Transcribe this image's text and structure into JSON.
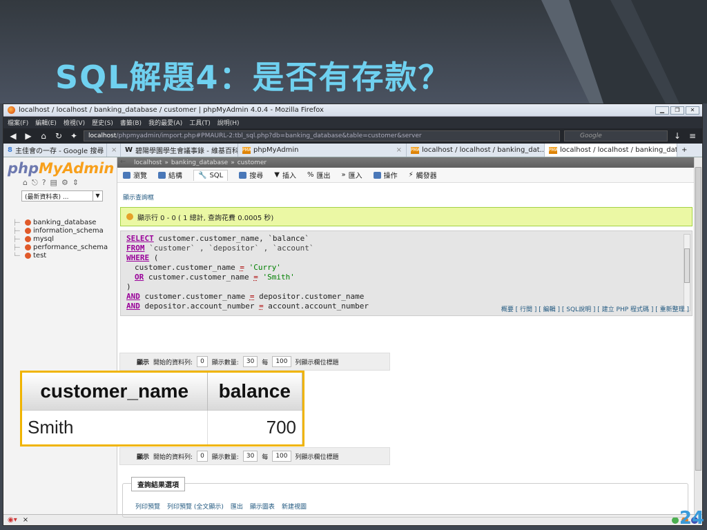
{
  "slide": {
    "title": "SQL解題4：是否有存款？",
    "page_number": "24"
  },
  "browser": {
    "window_title": "localhost / localhost / banking_database / customer | phpMyAdmin 4.0.4 - Mozilla Firefox",
    "menu": [
      "檔案(F)",
      "編輯(E)",
      "檢視(V)",
      "歷史(S)",
      "書籤(B)",
      "我的最愛(A)",
      "工具(T)",
      "說明(H)"
    ],
    "url_host": "localhost",
    "url_rest": "/phpmyadmin/import.php#PMAURL-2:tbl_sql.php?db=banking_database&table=customer&server",
    "search_placeholder": "Google",
    "tabs": [
      {
        "label": "主佳會の一存 - Google 搜尋"
      },
      {
        "label": "碧陽學園學生會議事錄 - 維基百科，..."
      },
      {
        "label": "phpMyAdmin"
      },
      {
        "label": "localhost / localhost / banking_dat..."
      },
      {
        "label": "localhost / localhost / banking_dat..."
      }
    ]
  },
  "pma": {
    "logo_php": "php",
    "logo_myadmin": "MyAdmin",
    "recent_select": "(最新資料表) ...",
    "databases": [
      "banking_database",
      "information_schema",
      "mysql",
      "performance_schema",
      "test"
    ],
    "breadcrumb": {
      "server": "localhost",
      "database": "banking_database",
      "table": "customer"
    },
    "tabs": [
      "瀏覽",
      "結構",
      "SQL",
      "搜尋",
      "插入",
      "匯出",
      "匯入",
      "操作",
      "觸發器"
    ],
    "show_query_box": "顯示查詢框",
    "success_message": "顯示行 0 - 0 ( 1 總計, 查詢花費 0.0005 秒)",
    "sql_lines": [
      {
        "kw": "SELECT",
        "text": " customer.customer_name, `balance`"
      },
      {
        "kw": "FROM",
        "text": " `customer` , `depositor` , `account`"
      },
      {
        "kw": "WHERE",
        "text": " ("
      },
      {
        "indent": "customer.customer_name ",
        "eq": "=",
        "str": " 'Curry'"
      },
      {
        "kw_ind": "OR",
        "indent": " customer.customer_name ",
        "eq": "=",
        "str": " 'Smith'"
      },
      {
        "plain": ")"
      },
      {
        "kw": "AND",
        "text": " customer.customer_name ",
        "eq": "=",
        "text2": " depositor.customer_name"
      },
      {
        "kw": "AND",
        "text": " depositor.account_number ",
        "eq": "=",
        "text2": " account.account_number"
      }
    ],
    "sql_links": "概要 [ 行間 ] [ 編輯 ] [ SQL說明 ] [ 建立 PHP 程式碼 ] [ 重新整理 ]",
    "nav": {
      "show_label": "顯示",
      "start_label": "開始的資料列:",
      "start_value": "0",
      "count_label": "顯示數量:",
      "count_value": "30",
      "per_label": "每",
      "per_value": "100",
      "header_label": "列顯示欄位標題"
    },
    "results": {
      "columns": [
        "customer_name",
        "balance"
      ],
      "rows": [
        [
          "Smith",
          "700"
        ]
      ]
    },
    "result_options": {
      "legend": "查詢結果選項",
      "links": [
        "列印預覽",
        "列印預覽 (全文顯示)",
        "匯出",
        "顯示圖表",
        "新建視圖"
      ]
    }
  }
}
